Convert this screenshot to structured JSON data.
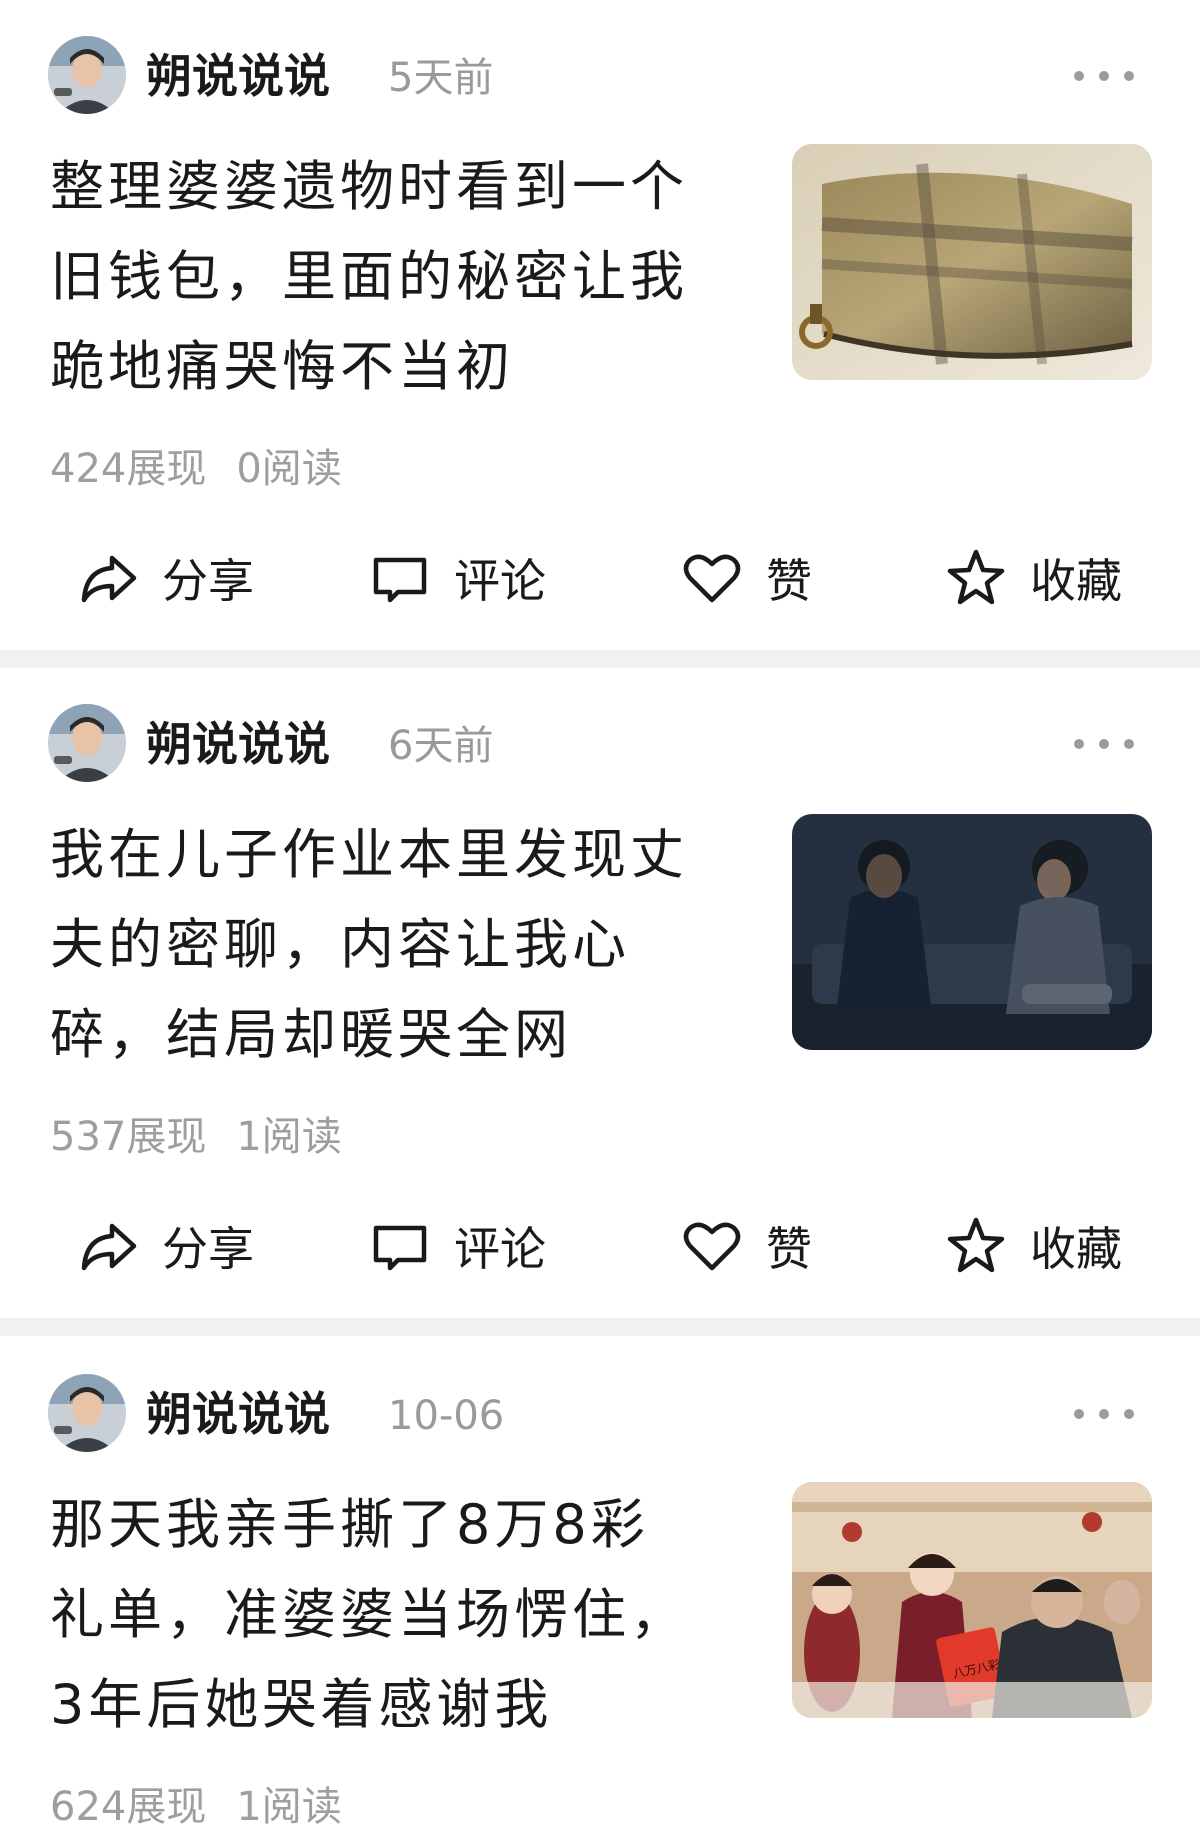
{
  "posts": [
    {
      "author": "朔说说说",
      "time": "5天前",
      "title_lines": [
        "整理婆婆遗物时看到一个",
        "旧钱包，里面的秘密让我",
        "跪地痛哭悔不当初"
      ],
      "impressions": "424展现",
      "reads": "0阅读"
    },
    {
      "author": "朔说说说",
      "time": "6天前",
      "title_lines": [
        "我在儿子作业本里发现丈",
        "夫的密聊，内容让我心",
        "碎，结局却暖哭全网"
      ],
      "impressions": "537展现",
      "reads": "1阅读"
    },
    {
      "author": "朔说说说",
      "time": "10-06",
      "title_lines": [
        "那天我亲手撕了8万8彩",
        "礼单，准婆婆当场愣住，",
        "3年后她哭着感谢我"
      ],
      "impressions": "624展现",
      "reads": "1阅读",
      "image_text": "八万八彩礼"
    }
  ],
  "actions": {
    "share": "分享",
    "comment": "评论",
    "like": "赞",
    "favorite": "收藏"
  },
  "icons": [
    "share-icon",
    "comment-icon",
    "like-icon",
    "favorite-icon",
    "more-icon"
  ]
}
